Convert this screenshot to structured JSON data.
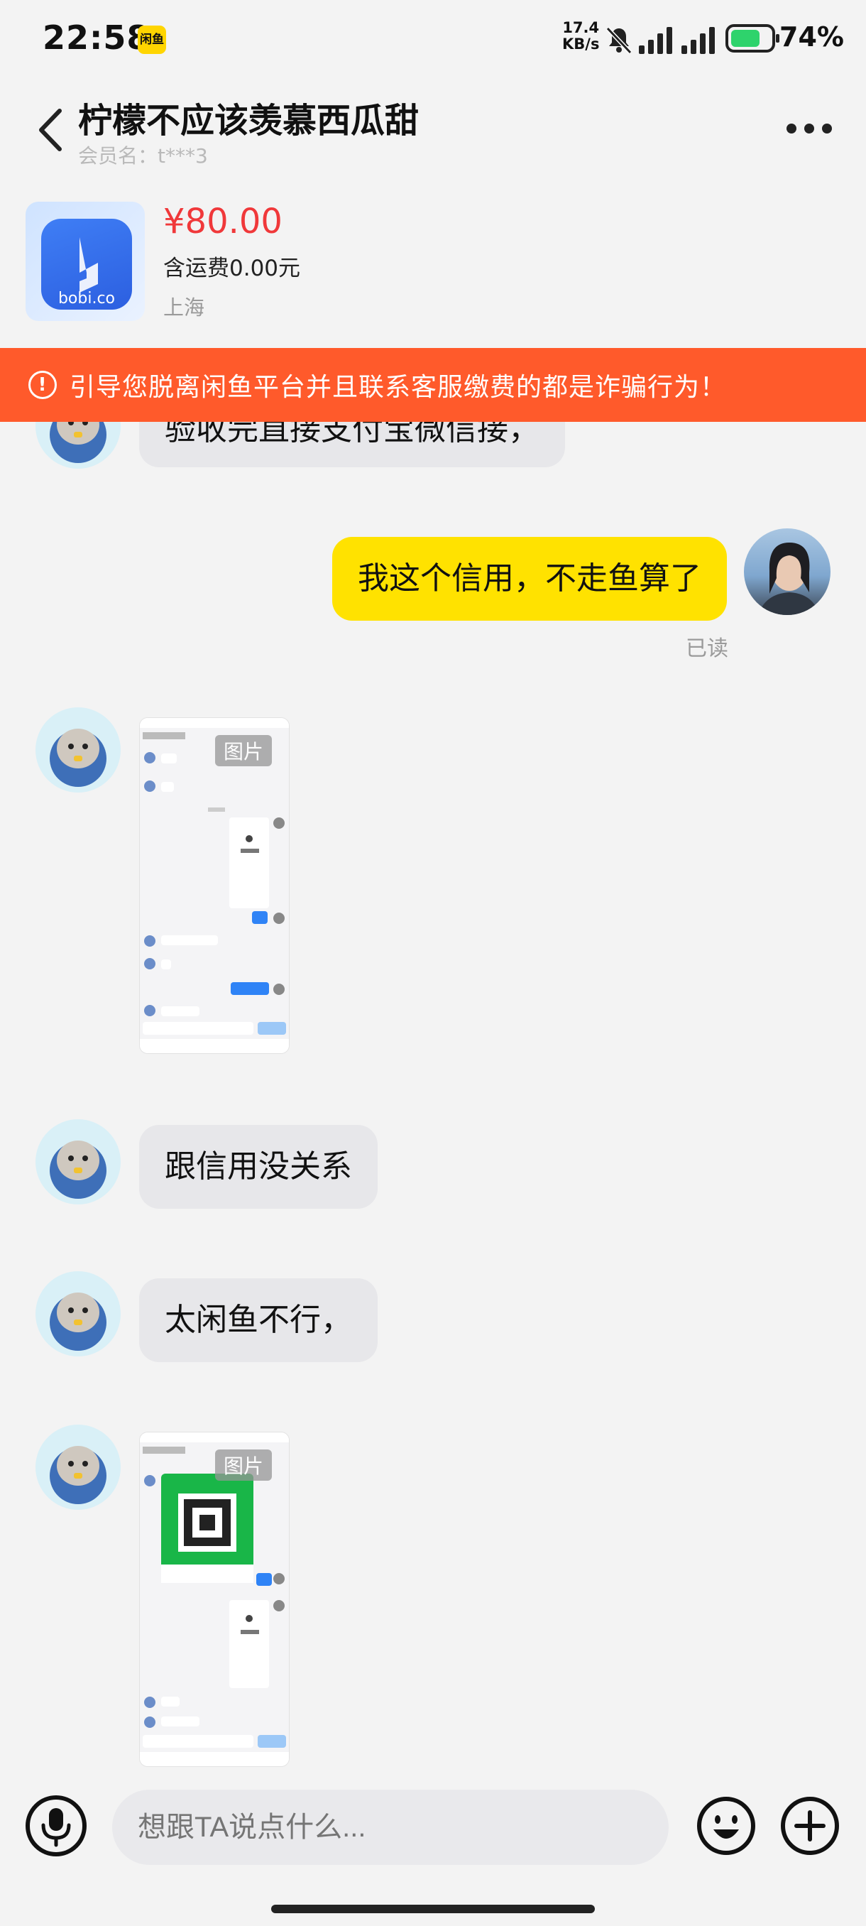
{
  "status_bar": {
    "time": "22:58",
    "notif_badge": "闲鱼",
    "speed_value": "17.4",
    "speed_unit": "KB/s",
    "battery_pct": "74%",
    "battery_level": 0.74
  },
  "header": {
    "title": "柠檬不应该羡慕西瓜甜",
    "member": "会员名：t***3"
  },
  "product": {
    "app_name": "bobi.co",
    "price": "¥80.00",
    "shipping": "含运费0.00元",
    "location": "上海"
  },
  "warning": {
    "icon_text": "!",
    "text": "引导您脱离闲鱼平台并且联系客服缴费的都是诈骗行为！"
  },
  "messages": {
    "partial_text": "验收完直接支付宝微信接，",
    "mine_text": "我这个信用，不走鱼算了",
    "read_status": "已读",
    "image_label_1": "图片",
    "reply_1": "跟信用没关系",
    "reply_2": "太闲鱼不行，",
    "image_label_2": "图片"
  },
  "input_bar": {
    "placeholder": "想跟TA说点什么..."
  },
  "colors": {
    "warning_bg": "#ff5a2b",
    "price": "#f0383a",
    "my_bubble": "#ffe200",
    "battery": "#2ed36c"
  }
}
